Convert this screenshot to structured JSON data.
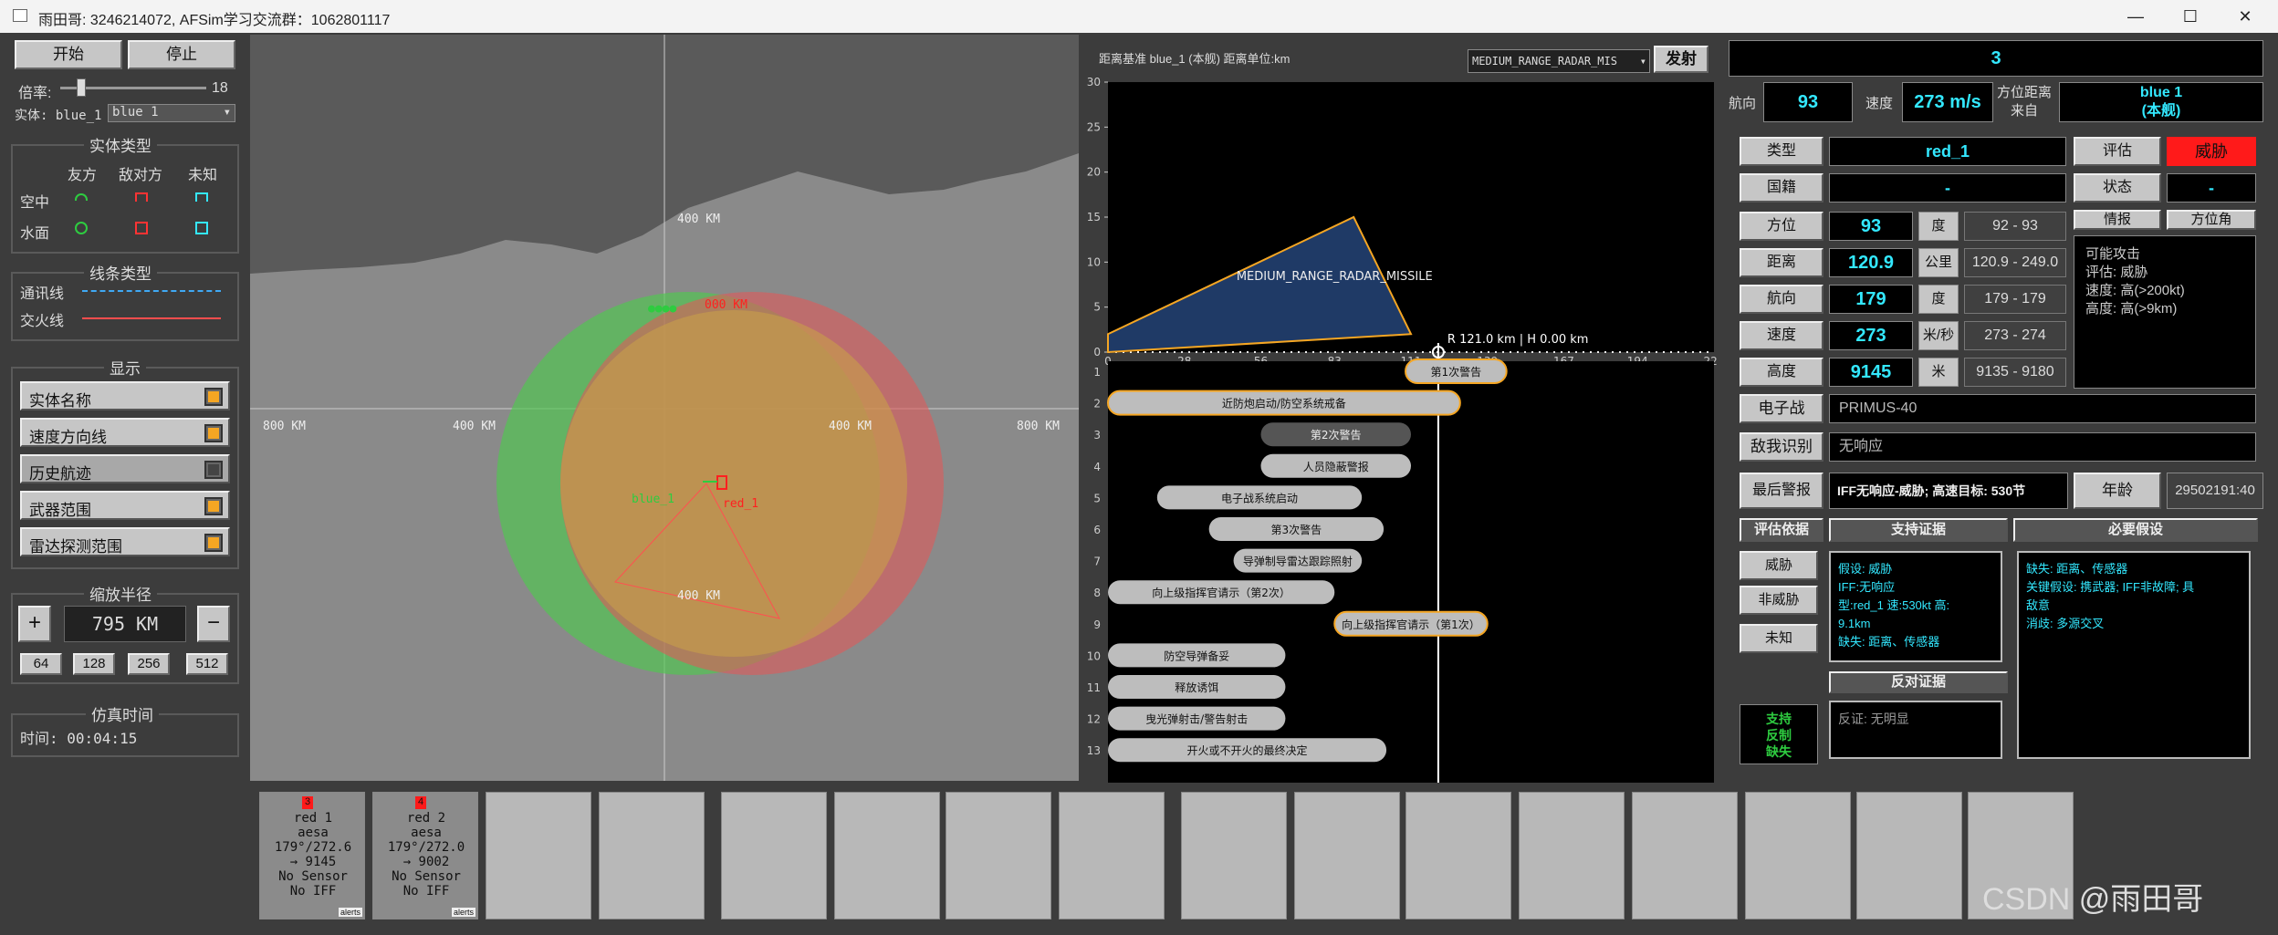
{
  "window": {
    "title": "雨田哥: 3246214072, AFSim学习交流群：1062801117",
    "min": "—",
    "max": "☐",
    "close": "✕"
  },
  "controls": {
    "start": "开始",
    "stop": "停止",
    "rate_label": "倍率:",
    "rate_value": "18",
    "entity_label": "实体: blue_1",
    "entity_select": "blue 1"
  },
  "entity_types": {
    "title": "实体类型",
    "cols": [
      "友方",
      "敌对方",
      "未知"
    ],
    "rows": [
      "空中",
      "水面"
    ]
  },
  "line_types": {
    "title": "线条类型",
    "comm": "通讯线",
    "fire": "交火线"
  },
  "display": {
    "title": "显示",
    "items": [
      "实体名称",
      "速度方向线",
      "历史航迹",
      "武器范围",
      "雷达探测范围"
    ],
    "states": [
      true,
      true,
      false,
      true,
      true
    ]
  },
  "zoom": {
    "title": "缩放半径",
    "plus": "+",
    "minus": "−",
    "value": "795  KM",
    "presets": [
      "64",
      "128",
      "256",
      "512"
    ]
  },
  "sim_time": {
    "title": "仿真时间",
    "label": "时间:  00:04:15"
  },
  "map": {
    "range_labels": [
      "400 KM",
      "400 KM",
      "800 KM",
      "400 KM",
      "400 KM",
      "800 KM"
    ],
    "blue_label": "blue_1",
    "red_label": "red_1",
    "top_green": "●●●●",
    "top_red": "000 KM"
  },
  "chart": {
    "header": "距离基准 blue_1 (本舰)   距离单位:km",
    "weapon_select": "MEDIUM_RANGE_RADAR_MIS",
    "fire": "发射",
    "y_ticks": [
      "30",
      "25",
      "20",
      "15",
      "10",
      "5",
      "0"
    ],
    "x_ticks": [
      "0",
      "28",
      "56",
      "83",
      "111",
      "139",
      "167",
      "194",
      "222"
    ],
    "poly_label": "MEDIUM_RANGE_RADAR_MISSILE",
    "cursor_label": "R 121.0 km | H 0.00 km"
  },
  "chart_data": {
    "type": "area",
    "title": "",
    "x": [
      0,
      90,
      111,
      0
    ],
    "y": [
      2,
      15,
      2,
      0
    ],
    "xlim": [
      0,
      222
    ],
    "ylim": [
      0,
      30
    ],
    "series": [
      {
        "name": "MEDIUM_RANGE_RADAR_MISSILE",
        "values": [
          2,
          15,
          2,
          0
        ]
      }
    ],
    "cursor": {
      "x": 121
    }
  },
  "timeline": [
    {
      "n": "1",
      "text": "第1次警告"
    },
    {
      "n": "2",
      "text": "近防炮启动/防空系统戒备"
    },
    {
      "n": "3",
      "text": "第2次警告"
    },
    {
      "n": "4",
      "text": "人员隐蔽警报"
    },
    {
      "n": "5",
      "text": "电子战系统启动"
    },
    {
      "n": "6",
      "text": "第3次警告"
    },
    {
      "n": "7",
      "text": "导弹制导雷达跟踪照射"
    },
    {
      "n": "8",
      "text": "向上级指挥官请示（第2次）"
    },
    {
      "n": "9",
      "text": "向上级指挥官请示（第1次）"
    },
    {
      "n": "10",
      "text": "防空导弹备妥"
    },
    {
      "n": "11",
      "text": "释放诱饵"
    },
    {
      "n": "12",
      "text": "曳光弹射击/警告射击"
    },
    {
      "n": "13",
      "text": "开火或不开火的最终决定"
    }
  ],
  "right": {
    "top_value": "3",
    "heading_label": "航向",
    "heading_value": "93",
    "speed_label": "速度",
    "speed_value": "273 m/s",
    "bearing_label": "方位距离\n来自",
    "from_value": "blue 1\n(本舰)",
    "type_label": "类型",
    "type_value": "red_1",
    "eval_label": "评估",
    "eval_value": "威胁",
    "nation_label": "国籍",
    "nation_value": "-",
    "state_label": "状态",
    "state_value": "-",
    "intel_tab": "情报",
    "bearing_tab": "方位角",
    "rows": [
      {
        "label": "方位",
        "value": "93",
        "unit": "度",
        "range": "92 - 93"
      },
      {
        "label": "距离",
        "value": "120.9",
        "unit": "公里",
        "range": "120.9 - 249.0"
      },
      {
        "label": "航向",
        "value": "179",
        "unit": "度",
        "range": "179 - 179"
      },
      {
        "label": "速度",
        "value": "273",
        "unit": "米/秒",
        "range": "273 - 274"
      },
      {
        "label": "高度",
        "value": "9145",
        "unit": "米",
        "range": "9135 - 9180"
      }
    ],
    "intel_text": [
      "可能攻击",
      "",
      "评估: 威胁",
      "速度: 高(>200kt)",
      "高度: 高(>9km)"
    ],
    "ew_label": "电子战",
    "ew_value": "PRIMUS-40",
    "iff_label": "敌我识别",
    "iff_value": "无响应",
    "alert_label": "最后警报",
    "alert_value": "IFF无响应-威胁; 高速目标: 530节",
    "age_label": "年龄",
    "age_value": "29502191:40",
    "basis_title": "评估依据",
    "support_title": "支持证据",
    "required_title": "必要假设",
    "basis_btns": [
      "威胁",
      "非威胁",
      "未知"
    ],
    "support_text": [
      "假设: 威胁",
      "IFF:无响应",
      "型:red_1 速:530kt 高:",
      "9.1km",
      "缺失: 距离、传感器"
    ],
    "required_text": [
      "缺失: 距离、传感器",
      "关键假设: 携武器; IFF非故障; 具",
      "敌意",
      "消歧: 多源交叉"
    ],
    "counter_title": "反对证据",
    "counter_text": "反证: 无明显",
    "status_text": [
      "支持",
      "反制",
      "缺失"
    ]
  },
  "cards": [
    {
      "name": "red 1",
      "sensor": "aesa",
      "vec": "179°/272.6",
      "alt": "→ 9145",
      "ns": "No Sensor",
      "iff": "No IFF",
      "tag": "alerts",
      "badge": "3"
    },
    {
      "name": "red 2",
      "sensor": "aesa",
      "vec": "179°/272.0",
      "alt": "→ 9002",
      "ns": "No Sensor",
      "iff": "No IFF",
      "tag": "alerts",
      "badge": "4"
    }
  ],
  "watermark": "CSDN @雨田哥",
  "colors": {
    "accent": "#33e8ff",
    "threat": "#ff1a1a",
    "hl": "#f5a623"
  }
}
